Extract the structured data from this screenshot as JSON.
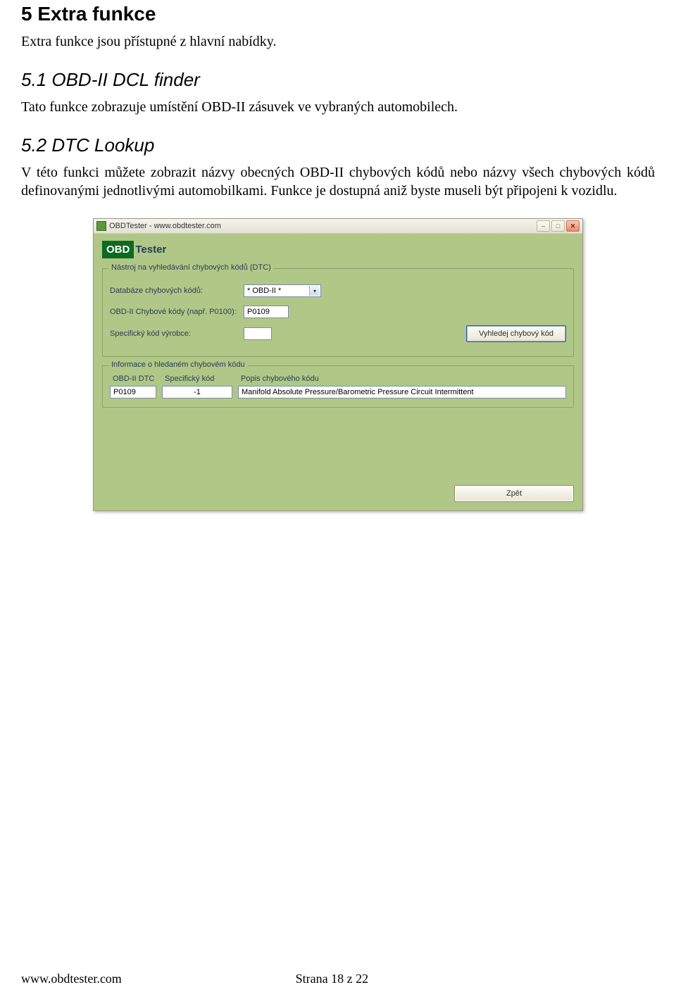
{
  "doc": {
    "h_main": "5 Extra funkce",
    "p_intro": "Extra funkce jsou přístupné z hlavní nabídky.",
    "h_5_1": "5.1  OBD-II DCL finder",
    "p_5_1": "Tato funkce zobrazuje umístění OBD-II zásuvek ve vybraných automobilech.",
    "h_5_2": "5.2  DTC Lookup",
    "p_5_2": "V této funkci můžete zobrazit názvy obecných OBD-II chybových kódů nebo názvy všech chybových kódů definovanými jednotlivými automobilkami. Funkce je dostupná aniž byste museli být připojeni k vozidlu."
  },
  "app": {
    "title": "OBDTester - www.obdtester.com",
    "logo_left": "OBD",
    "logo_right": "Tester",
    "search_group": {
      "legend": "Nástroj na vyhledávání chybových kódů (DTC)",
      "db_label": "Databáze chybových kódů:",
      "db_value": "* OBD-II *",
      "code_label": "OBD-II Chybové kódy (např. P0100):",
      "code_value": "P0109",
      "manuf_label": "Specifický kód výrobce:",
      "manuf_value": "",
      "search_btn": "Vyhledej chybový kód"
    },
    "info_group": {
      "legend": "Informace o hledaném chybovém kódu",
      "col_dtc": "OBD-II DTC",
      "col_spec": "Specifický kód",
      "col_desc": "Popis chybového kódu",
      "row": {
        "dtc": "P0109",
        "spec": "-1",
        "desc": "Manifold Absolute Pressure/Barometric Pressure Circuit Intermittent"
      }
    },
    "back_btn": "Zpět"
  },
  "footer": {
    "left": "www.obdtester.com",
    "right": "Strana 18 z 22"
  }
}
